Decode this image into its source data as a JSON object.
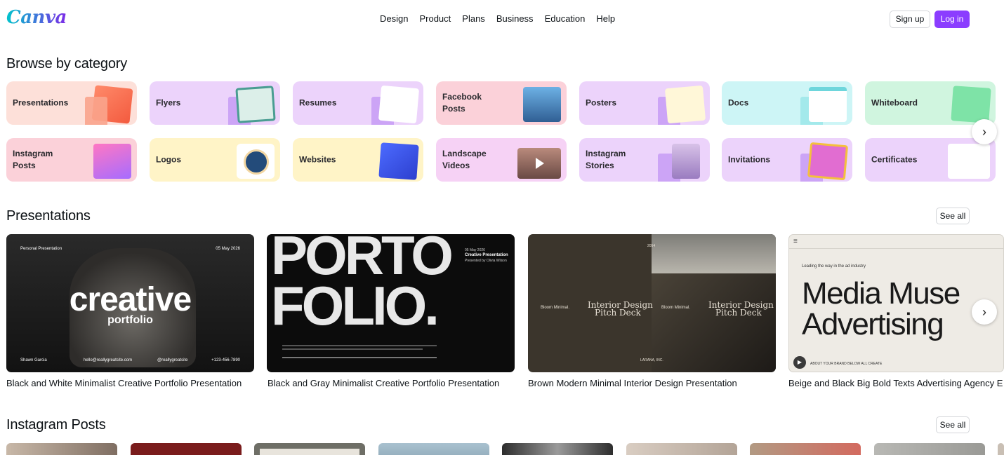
{
  "header": {
    "logo": "Canva",
    "nav": [
      "Design",
      "Product",
      "Plans",
      "Business",
      "Education",
      "Help"
    ],
    "signup": "Sign up",
    "login": "Log in"
  },
  "browse": {
    "title": "Browse by category",
    "row1": [
      "Presentations",
      "Flyers",
      "Resumes",
      "Facebook Posts",
      "Posters",
      "Docs",
      "Whiteboard"
    ],
    "row2": [
      "Instagram Posts",
      "Logos",
      "Websites",
      "Landscape Videos",
      "Instagram Stories",
      "Invitations",
      "Certificates"
    ]
  },
  "presentations": {
    "title": "Presentations",
    "see_all": "See all",
    "items": [
      {
        "caption": "Black and White Minimalist Creative Portfolio Presentation",
        "big": "creative",
        "sub": "portfolio",
        "top_left": "Personal Presentation",
        "top_right": "05 May 2026",
        "bottom_left": "Shawn Garcia",
        "bottom_mid": "hello@reallygreatsite.com",
        "bottom_mid2": "@reallygreatsite",
        "bottom_right": "+123-456-7890"
      },
      {
        "caption": "Black and Gray Minimalist Creative Portfolio Presentation",
        "line1": "PORTO",
        "line2": "FOLIO.",
        "tr_date": "05 May 2026",
        "tr_title": "Creative Presentation",
        "tr_sub": "Presented by Olivia Wilson"
      },
      {
        "caption": "Brown Modern Minimal Interior Design Presentation",
        "left_brand": "Bloom Minimal.",
        "left_title1": "Interior Design",
        "left_title2": "Pitch Deck",
        "right_brand": "Bloom Minimal.",
        "right_title1": "Interior Design",
        "right_title2": "Pitch Deck",
        "year": "2054",
        "bottom": "LARANA, INC."
      },
      {
        "caption": "Beige and Black Big Bold Texts Advertising Agency E",
        "tag": "Leading the way in the ad industry",
        "line1": "Media Muse",
        "line2": "Advertising",
        "footer": "ABOUT YOUR BRAND BELOW ALL CREATE"
      }
    ]
  },
  "instagram": {
    "title": "Instagram Posts",
    "see_all": "See all"
  },
  "colors": {
    "brand": "#8b3dff",
    "presentations_bg": "#fde0d9",
    "flyers_bg": "#ecd3fb",
    "docs_bg": "#cdf5f6",
    "whiteboard_bg": "#d0f5df",
    "logos_bg": "#fff4c7"
  }
}
